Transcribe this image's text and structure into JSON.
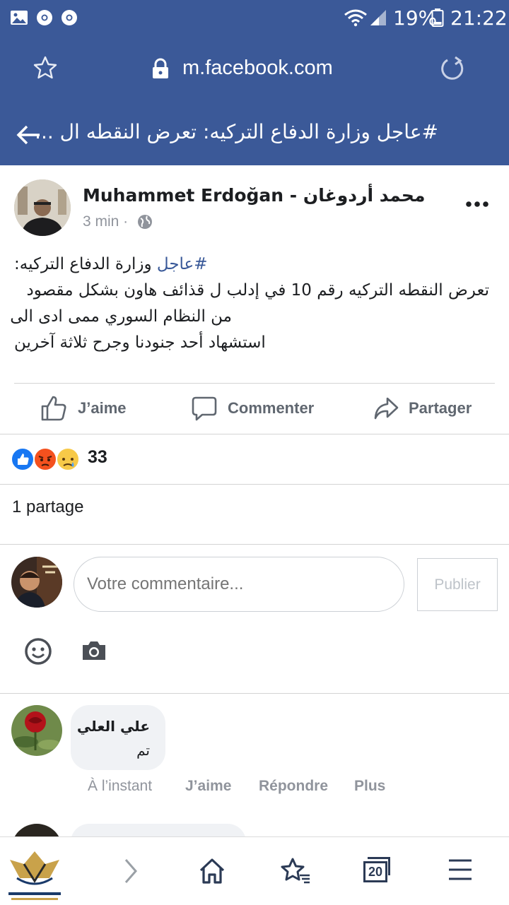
{
  "status_bar": {
    "battery": "19%",
    "time": "21:22"
  },
  "url_bar": {
    "url": "m.facebook.com"
  },
  "title_bar": {
    "title": "#عاجل وزارة الدفاع التركيه: تعرض النقطه ال ..."
  },
  "post": {
    "author": "Muhammet Erdoğan - محمد أردوغان",
    "time": "3 min ·",
    "lines": {
      "l1_text": "وزارة الدفاع التركيه",
      "l1_hashtag": "#عاجل",
      "l1_colon": ":",
      "l2": "تعرض النقطه التركيه رقم 10 في إدلب ل قذائف هاون بشكل مقصود",
      "l3": "من النظام السوري ممى ادى الى",
      "l4": "استشهاد أحد جنودنا وجرح ثلاثة آخرين"
    },
    "actions": {
      "like": "J’aime",
      "comment": "Commenter",
      "share": "Partager"
    },
    "reactions_count": "33",
    "shares": "1 partage"
  },
  "composer": {
    "placeholder": "Votre commentaire...",
    "publish": "Publier"
  },
  "comments": [
    {
      "author": "علي العلي",
      "text": "تم",
      "time": "À l’instant",
      "like": "J’aime",
      "reply": "Répondre",
      "more": "Plus"
    }
  ],
  "bottom_nav": {
    "tabs_count": "20"
  },
  "colors": {
    "brand": "#3b5998",
    "link": "#385898",
    "muted": "#90949c"
  }
}
